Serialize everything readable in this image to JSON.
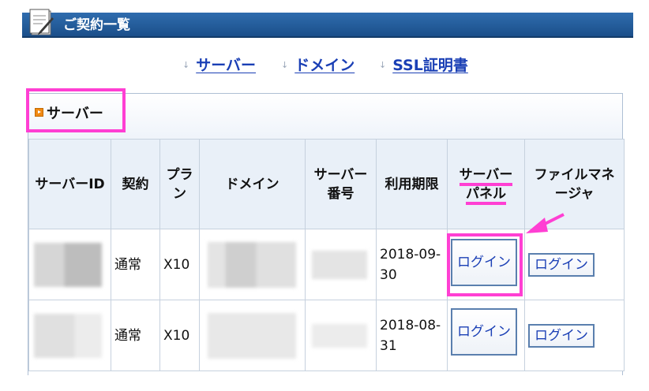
{
  "header": {
    "title": "ご契約一覧"
  },
  "nav": {
    "items": [
      {
        "arrow": "↓",
        "label": "サーバー"
      },
      {
        "arrow": "↓",
        "label": "ドメイン"
      },
      {
        "arrow": "↓",
        "label": "SSL証明書"
      }
    ]
  },
  "section": {
    "title": "サーバー"
  },
  "table": {
    "headers": [
      "サーバーID",
      "契約",
      "プラン",
      "ドメイン",
      "サーバー番号",
      "利用期限",
      "サーバーパネル",
      "ファイルマネージャ"
    ],
    "panel_header_lines": [
      "サーバー",
      "パネル"
    ],
    "rows": [
      {
        "contract": "通常",
        "plan": "X10",
        "expiry": "2018-09-30",
        "panel_button": "ログイン",
        "file_button": "ログイン"
      },
      {
        "contract": "通常",
        "plan": "X10",
        "expiry": "2018-08-31",
        "panel_button": "ログイン",
        "file_button": "ログイン"
      }
    ]
  },
  "colors": {
    "header_bar": "#1b4f8a",
    "link": "#1a3fb5",
    "annotation": "#ff3fd3"
  }
}
